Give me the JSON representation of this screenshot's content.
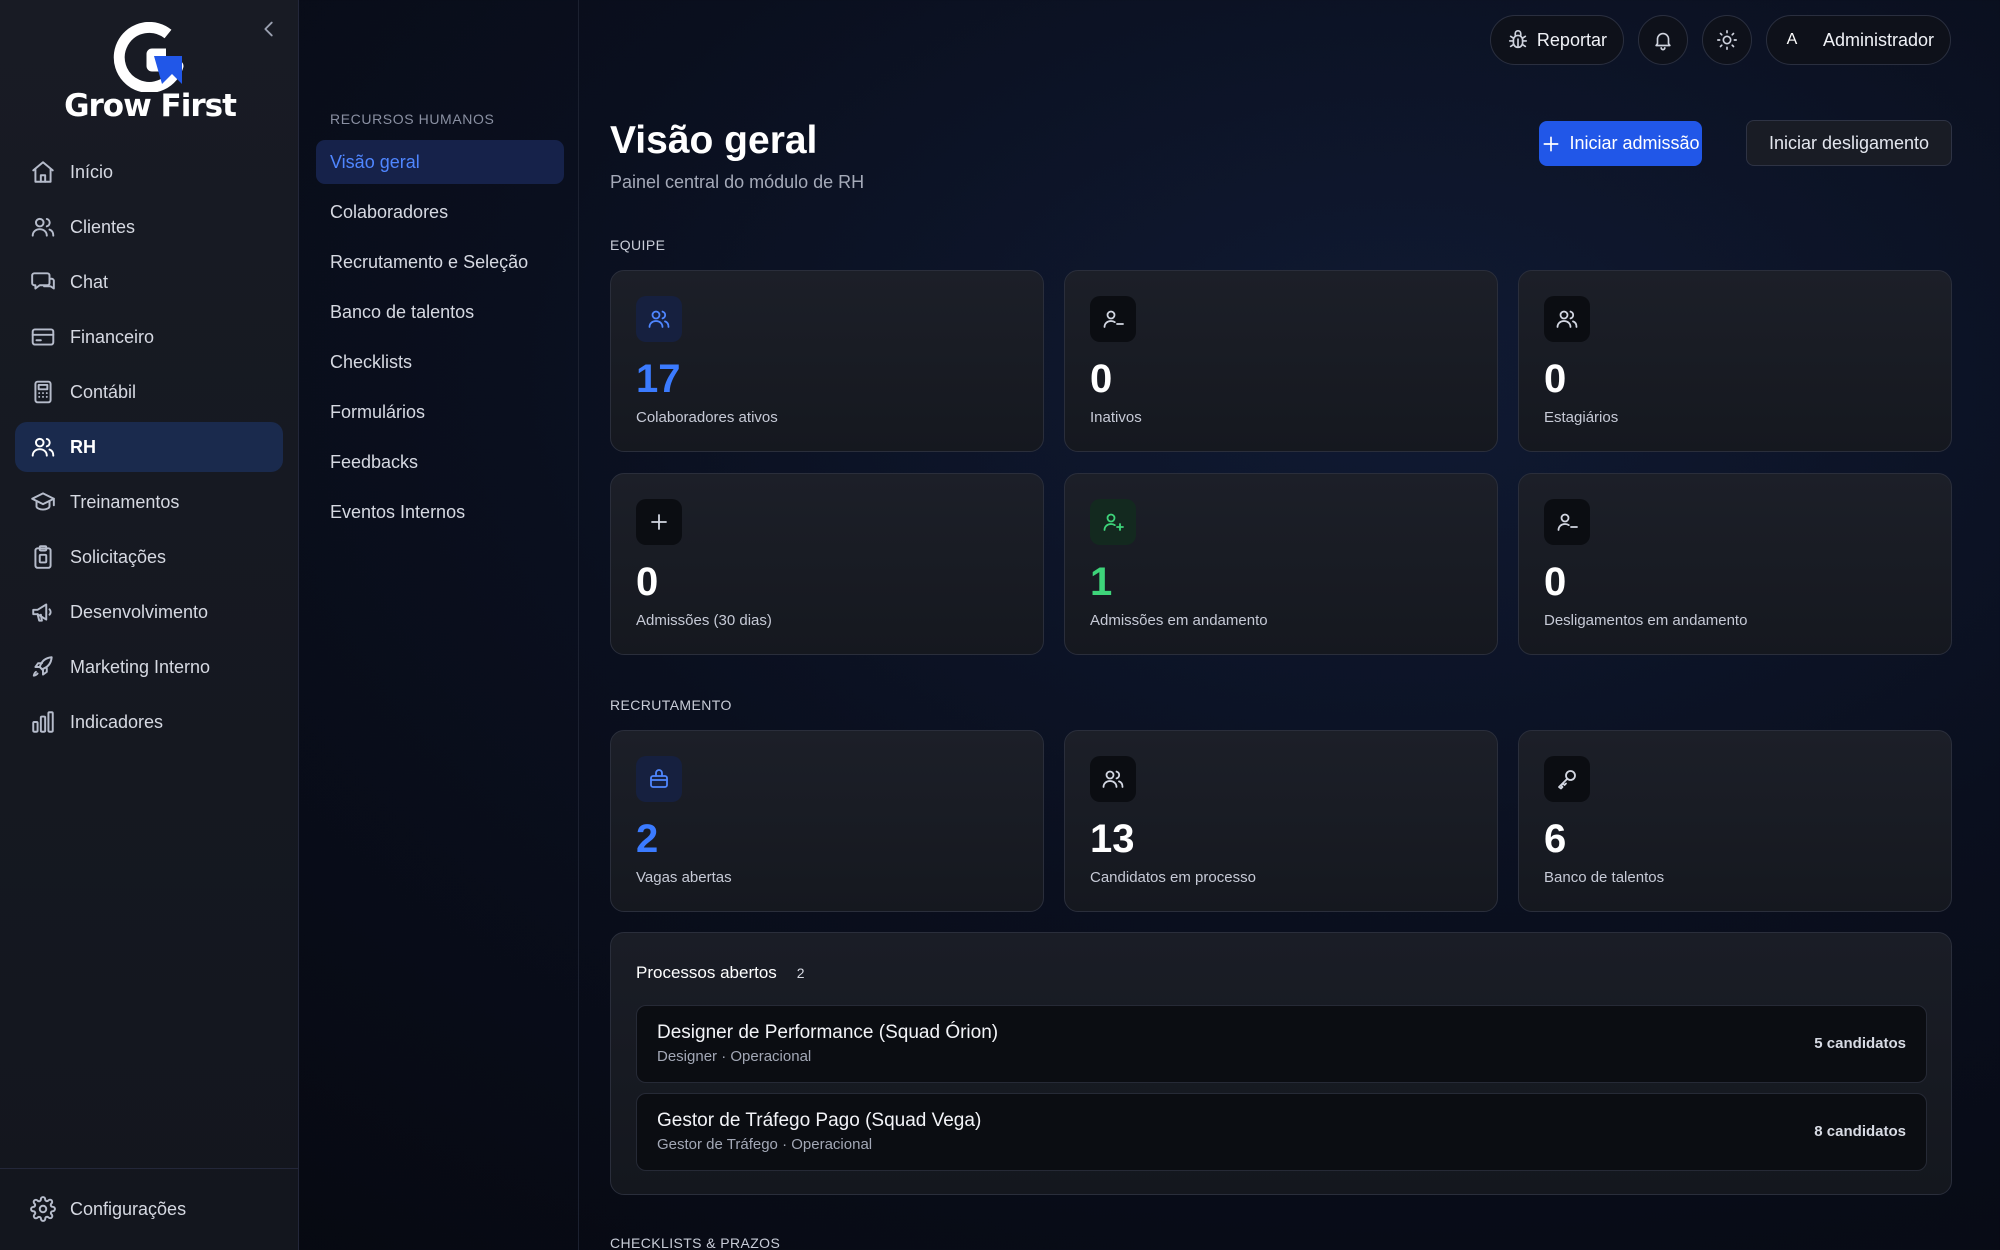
{
  "brand": {
    "name": "Grow First"
  },
  "sidebar": {
    "items": [
      {
        "label": "Início",
        "icon": "home-icon"
      },
      {
        "label": "Clientes",
        "icon": "users-icon"
      },
      {
        "label": "Chat",
        "icon": "chat-icon"
      },
      {
        "label": "Financeiro",
        "icon": "credit-card-icon"
      },
      {
        "label": "Contábil",
        "icon": "calculator-icon"
      },
      {
        "label": "RH",
        "icon": "users-icon",
        "active": true
      },
      {
        "label": "Treinamentos",
        "icon": "graduation-cap-icon"
      },
      {
        "label": "Solicitações",
        "icon": "clipboard-icon"
      },
      {
        "label": "Desenvolvimento",
        "icon": "megaphone-icon"
      },
      {
        "label": "Marketing Interno",
        "icon": "rocket-icon"
      },
      {
        "label": "Indicadores",
        "icon": "bar-chart-icon"
      }
    ],
    "settings_label": "Configurações"
  },
  "submenu": {
    "title": "RECURSOS HUMANOS",
    "items": [
      {
        "label": "Visão geral",
        "active": true
      },
      {
        "label": "Colaboradores"
      },
      {
        "label": "Recrutamento e Seleção"
      },
      {
        "label": "Banco de talentos"
      },
      {
        "label": "Checklists"
      },
      {
        "label": "Formulários"
      },
      {
        "label": "Feedbacks"
      },
      {
        "label": "Eventos Internos"
      }
    ]
  },
  "topbar": {
    "report_label": "Reportar",
    "user_initial": "A",
    "user_name": "Administrador"
  },
  "header": {
    "title": "Visão geral",
    "subtitle": "Painel central do módulo de RH",
    "primary_action": "Iniciar admissão",
    "secondary_action": "Iniciar desligamento"
  },
  "sections": {
    "equipe": "EQUIPE",
    "recrutamento": "RECRUTAMENTO",
    "checklists": "CHECKLISTS & PRAZOS"
  },
  "equipe_cards": [
    {
      "value": "17",
      "label": "Colaboradores ativos",
      "icon": "users-icon",
      "accent": "blue"
    },
    {
      "value": "0",
      "label": "Inativos",
      "icon": "user-minus-icon",
      "accent": "none"
    },
    {
      "value": "0",
      "label": "Estagiários",
      "icon": "users-icon",
      "accent": "none"
    },
    {
      "value": "0",
      "label": "Admissões (30 dias)",
      "icon": "plus-icon",
      "accent": "none"
    },
    {
      "value": "1",
      "label": "Admissões em andamento",
      "icon": "user-plus-icon",
      "accent": "green"
    },
    {
      "value": "0",
      "label": "Desligamentos em andamento",
      "icon": "user-minus-icon",
      "accent": "none"
    }
  ],
  "recrutamento_cards": [
    {
      "value": "2",
      "label": "Vagas abertas",
      "icon": "briefcase-icon",
      "accent": "blue"
    },
    {
      "value": "13",
      "label": "Candidatos em processo",
      "icon": "users-icon",
      "accent": "none"
    },
    {
      "value": "6",
      "label": "Banco de talentos",
      "icon": "key-icon",
      "accent": "none"
    }
  ],
  "processes": {
    "title": "Processos abertos",
    "count": "2",
    "rows": [
      {
        "name": "Designer de Performance (Squad Órion)",
        "meta": "Designer · Operacional",
        "candidates": "5 candidatos"
      },
      {
        "name": "Gestor de Tráfego Pago (Squad Vega)",
        "meta": "Gestor de Tráfego · Operacional",
        "candidates": "8 candidatos"
      }
    ]
  },
  "colors": {
    "accent_blue": "#2157e8",
    "value_blue": "#3b7bff",
    "value_green": "#3ed47a",
    "active_nav": "#1a2a4d"
  }
}
